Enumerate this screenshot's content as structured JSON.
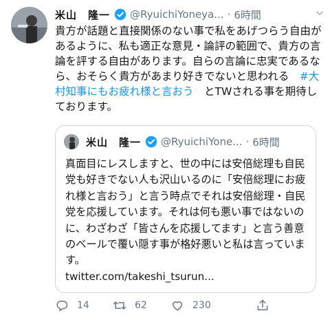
{
  "tweet": {
    "author_name": "米山　隆一",
    "handle": "@RyuichiYoneya...",
    "separator": "·",
    "time": "6時間",
    "text_before_hashtag": "貴方が話題と直接関係のない事で私をあげつらう自由があるように、私も適正な意見・論評の範囲で、貴方の言論を評する自由があります。自らの言論に忠実であるなら、おそらく貴方があまり好きでないと思われる　",
    "hashtag": "#大村知事にもお疲れ様と言おう",
    "text_after_hashtag": "　とTWされる事を期待しております。"
  },
  "quoted": {
    "author_name": "米山　隆一",
    "handle": "@RyuichiYone...",
    "separator": "·",
    "time": "6時間",
    "text": "真面目にレスしますと、世の中には安倍総理も自民党も好きでない人も沢山いるのに「安倍総理にお疲れ様と言おう」と言う時点でそれは安倍総理・自民党を応援しています。それは何も悪い事ではないのに、わざわざ「皆さんを応援してます」と言う善意のベールで覆い隠す事が格好悪いと私は言っています。\ntwitter.com/takeshi_tsurun..."
  },
  "actions": {
    "reply_count": "14",
    "retweet_count": "62",
    "like_count": "230",
    "icons": [
      "reply-icon",
      "retweet-icon",
      "like-icon",
      "share-icon"
    ]
  },
  "colors": {
    "text": "#14171a",
    "secondary": "#657786",
    "link": "#1b95e0",
    "border": "#ccd6dd"
  }
}
